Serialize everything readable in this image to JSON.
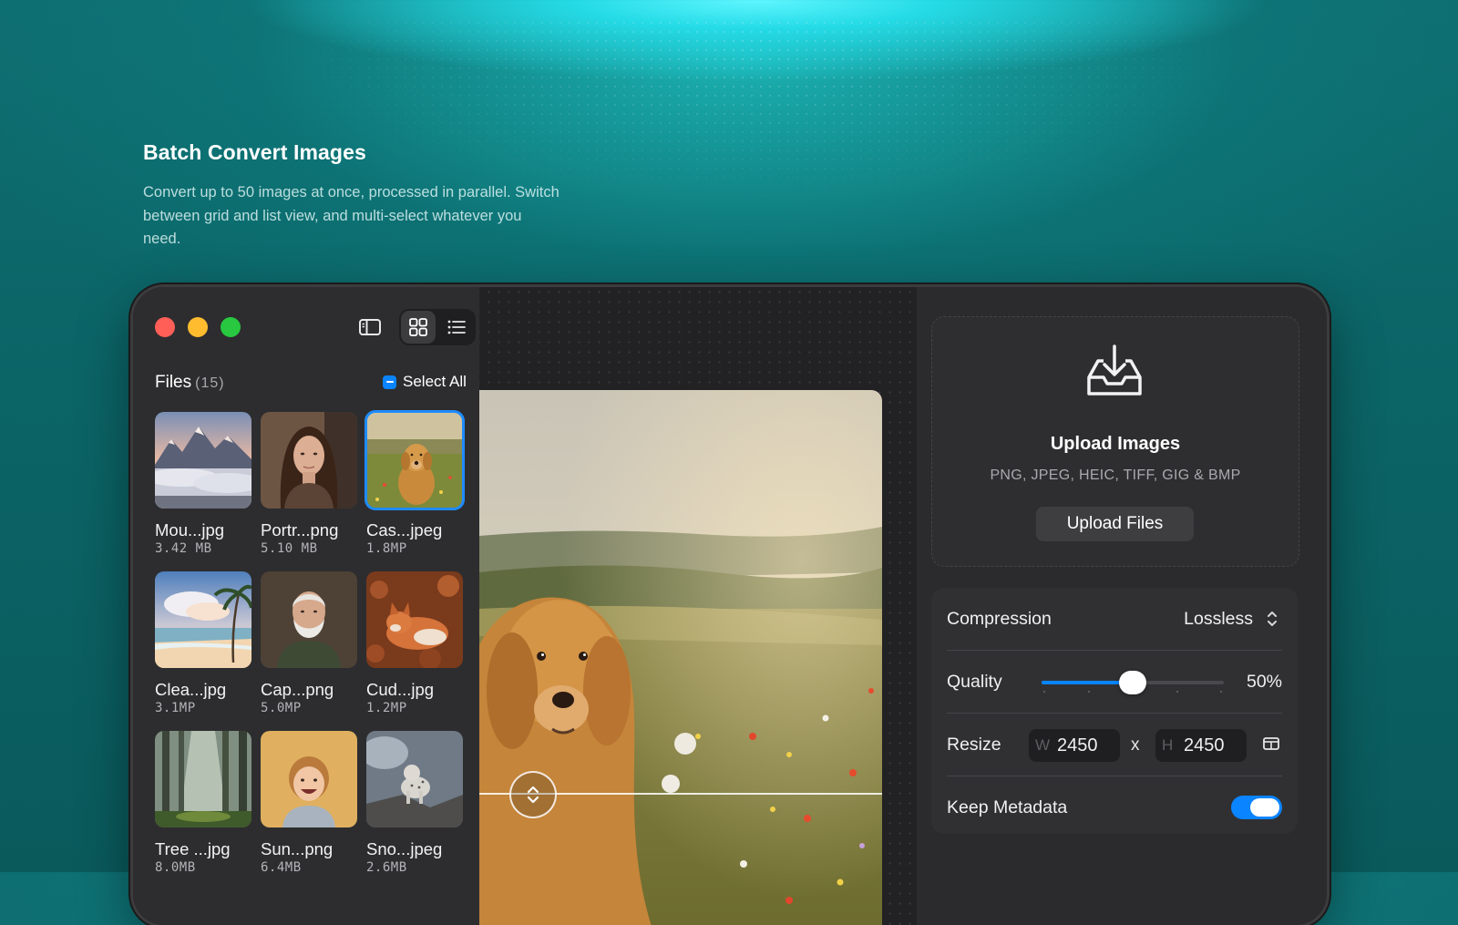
{
  "hero": {
    "title": "Batch Convert Images",
    "description": "Convert up to 50 images at once, processed in parallel. Switch between grid and list view, and multi-select whatever you need."
  },
  "sidebar": {
    "files_label": "Files",
    "files_count": "(15)",
    "select_all_label": "Select All",
    "view_mode": "grid",
    "files": [
      {
        "name": "Mou...jpg",
        "size": "3.42 MB",
        "selected": false,
        "thumb": "mountains"
      },
      {
        "name": "Portr...png",
        "size": "5.10 MB",
        "selected": false,
        "thumb": "portrait-woman"
      },
      {
        "name": "Cas...jpeg",
        "size": "1.8MP",
        "selected": true,
        "thumb": "golden-retriever"
      },
      {
        "name": "Clea...jpg",
        "size": "3.1MP",
        "selected": false,
        "thumb": "beach"
      },
      {
        "name": "Cap...png",
        "size": "5.0MP",
        "selected": false,
        "thumb": "old-man"
      },
      {
        "name": "Cud...jpg",
        "size": "1.2MP",
        "selected": false,
        "thumb": "fox"
      },
      {
        "name": "Tree ...jpg",
        "size": "8.0MB",
        "selected": false,
        "thumb": "forest"
      },
      {
        "name": "Sun...png",
        "size": "6.4MB",
        "selected": false,
        "thumb": "child"
      },
      {
        "name": "Sno...jpeg",
        "size": "2.6MB",
        "selected": false,
        "thumb": "snow-leopard"
      }
    ]
  },
  "upload": {
    "title": "Upload Images",
    "formats": "PNG, JPEG, HEIC, TIFF, GIG & BMP",
    "button_label": "Upload Files"
  },
  "settings": {
    "compression_label": "Compression",
    "compression_value": "Lossless",
    "quality_label": "Quality",
    "quality_value": "50%",
    "quality_fraction": 0.5,
    "resize_label": "Resize",
    "width_prefix": "W",
    "width_value": "2450",
    "height_prefix": "H",
    "height_value": "2450",
    "times_symbol": "x",
    "metadata_label": "Keep Metadata",
    "metadata_enabled": true
  },
  "colors": {
    "accent": "#0a84ff",
    "close": "#ff5f57",
    "minimize": "#febc2e",
    "zoom": "#28c840"
  }
}
